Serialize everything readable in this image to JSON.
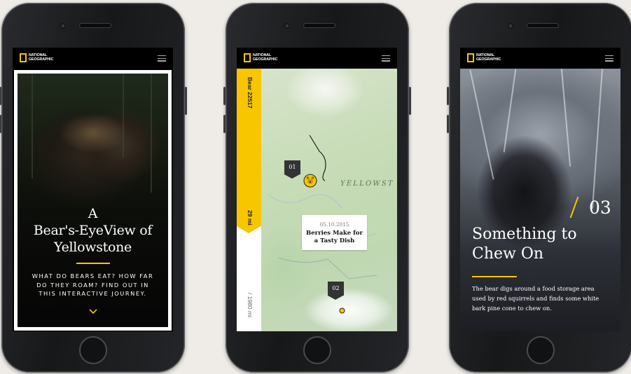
{
  "brand": {
    "logo_line1": "NATIONAL",
    "logo_line2": "GEOGRAPHIC",
    "accent": "#f7c600"
  },
  "phones": [
    {
      "screen": "intro",
      "title_line1": "A",
      "title_line2": "Bear's-EyeView of",
      "title_line3": "Yellowstone",
      "subtitle_line1": "WHAT DO BEARS EAT? HOW FAR",
      "subtitle_line2": "DO THEY ROAM? FIND OUT IN",
      "subtitle_line3": "THIS INTERACTIVE JOURNEY.",
      "scroll_icon": "chevron-down-icon"
    },
    {
      "screen": "map",
      "bear_label": "Bear 22517",
      "distance_label": "29 mi",
      "total_label": "/ 1980 mi",
      "progress_fraction": 0.6,
      "map_label": "YELLOWST",
      "pins": [
        {
          "label": "01"
        },
        {
          "label": "02"
        }
      ],
      "callout_date": "05.10.2015",
      "callout_line1": "Berries Make for",
      "callout_line2": "a Tasty Dish",
      "marker_icon": "bear-face-icon"
    },
    {
      "screen": "chapter",
      "chapter_number": "03",
      "title_line1": "Something to",
      "title_line2": "Chew On",
      "body_line1": "The bear digs around a food storage area",
      "body_line2": "used by red squirrels and finds some white",
      "body_line3": "bark pine cone to chew on."
    }
  ]
}
